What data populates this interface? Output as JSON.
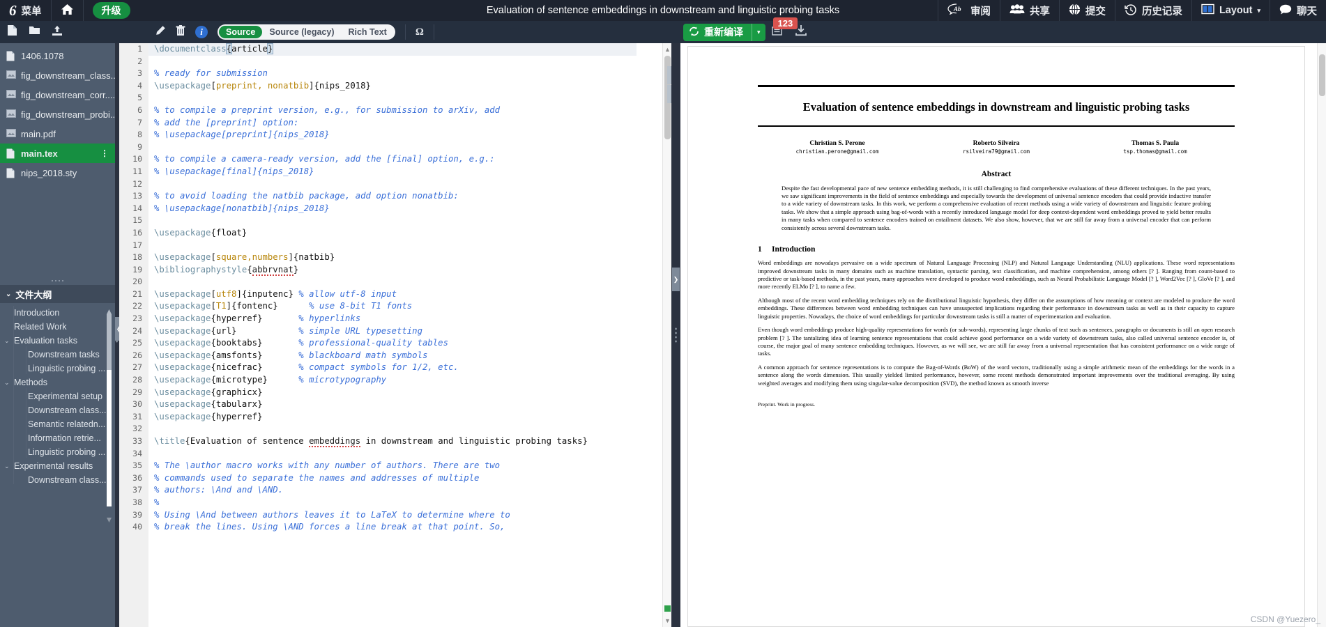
{
  "topbar": {
    "logo": "6",
    "menu_label": "菜单",
    "home_icon": "home-icon",
    "upgrade_label": "升级",
    "project_title": "Evaluation of sentence embeddings in downstream and linguistic probing tasks",
    "right_items": [
      {
        "label": "审阅",
        "icon": "review-ab-icon"
      },
      {
        "label": "共享",
        "icon": "people-icon"
      },
      {
        "label": "提交",
        "icon": "globe-icon"
      },
      {
        "label": "历史记录",
        "icon": "history-clock-icon"
      },
      {
        "label": "Layout",
        "icon": "layout-columns-icon",
        "caret": "▾"
      },
      {
        "label": "聊天",
        "icon": "chat-bubble-icon"
      }
    ]
  },
  "subbar": {
    "left_icons": [
      "new-file-icon",
      "new-folder-icon",
      "upload-icon"
    ],
    "edit_icons": [
      "rename-pencil-icon",
      "delete-trash-icon"
    ],
    "info_label": "i",
    "modes": [
      {
        "label": "Source",
        "active": true
      },
      {
        "label": "Source (legacy)",
        "active": false
      },
      {
        "label": "Rich Text",
        "active": false
      }
    ],
    "symbol_palette": "Ω",
    "recompile_label": "重新编译",
    "recompile_icon": "recycle-refresh-icon",
    "recompile_caret": "▾",
    "error_count": "123",
    "error_icon": "log-icon",
    "download_icon": "download-icon"
  },
  "sidebar": {
    "files": [
      {
        "name": "1406.1078",
        "icon": "file-icon",
        "selected": false
      },
      {
        "name": "fig_downstream_class...",
        "icon": "image-icon",
        "selected": false
      },
      {
        "name": "fig_downstream_corr....",
        "icon": "image-icon",
        "selected": false
      },
      {
        "name": "fig_downstream_probi...",
        "icon": "image-icon",
        "selected": false
      },
      {
        "name": "main.pdf",
        "icon": "image-icon",
        "selected": false
      },
      {
        "name": "main.tex",
        "icon": "file-icon",
        "selected": true,
        "kebab": "⋮"
      },
      {
        "name": "nips_2018.sty",
        "icon": "file-icon",
        "selected": false
      }
    ],
    "outline_title": "文件大纲",
    "outline_chevron": "⌄",
    "outline": [
      {
        "label": "Introduction",
        "level": 0,
        "chevron": ""
      },
      {
        "label": "Related Work",
        "level": 0,
        "chevron": ""
      },
      {
        "label": "Evaluation tasks",
        "level": 0,
        "chevron": "⌄"
      },
      {
        "label": "Downstream tasks",
        "level": 1,
        "chevron": ""
      },
      {
        "label": "Linguistic probing ...",
        "level": 1,
        "chevron": ""
      },
      {
        "label": "Methods",
        "level": 0,
        "chevron": "⌄"
      },
      {
        "label": "Experimental setup",
        "level": 1,
        "chevron": ""
      },
      {
        "label": "Downstream class...",
        "level": 1,
        "chevron": ""
      },
      {
        "label": "Semantic relatedn...",
        "level": 1,
        "chevron": ""
      },
      {
        "label": "Information retrie...",
        "level": 1,
        "chevron": ""
      },
      {
        "label": "Linguistic probing ...",
        "level": 1,
        "chevron": ""
      },
      {
        "label": "Experimental results",
        "level": 0,
        "chevron": "⌄"
      },
      {
        "label": "Downstream class...",
        "level": 1,
        "chevron": ""
      }
    ]
  },
  "editor": {
    "lines": [
      {
        "n": 1,
        "current": true,
        "segs": [
          {
            "t": "\\documentclass",
            "c": "cmd"
          },
          {
            "t": "{",
            "c": "sel-brace"
          },
          {
            "t": "article",
            "c": "arg"
          },
          {
            "t": "}",
            "c": "sel-brace"
          }
        ],
        "caret": true
      },
      {
        "n": 2,
        "segs": []
      },
      {
        "n": 3,
        "segs": [
          {
            "t": "% ready for submission",
            "c": "com"
          }
        ]
      },
      {
        "n": 4,
        "segs": [
          {
            "t": "\\usepackage",
            "c": "cmd"
          },
          {
            "t": "[",
            "c": "arg"
          },
          {
            "t": "preprint, nonatbib",
            "c": "opt"
          },
          {
            "t": "]{nips_2018}",
            "c": "arg"
          }
        ]
      },
      {
        "n": 5,
        "segs": []
      },
      {
        "n": 6,
        "segs": [
          {
            "t": "% to compile a preprint version, e.g., for submission to arXiv, add",
            "c": "com"
          }
        ]
      },
      {
        "n": 7,
        "segs": [
          {
            "t": "% add the [preprint] option:",
            "c": "com"
          }
        ]
      },
      {
        "n": 8,
        "segs": [
          {
            "t": "% \\usepackage[preprint]{nips_2018}",
            "c": "com"
          }
        ]
      },
      {
        "n": 9,
        "segs": []
      },
      {
        "n": 10,
        "segs": [
          {
            "t": "% to compile a camera-ready version, add the [final] option, e.g.:",
            "c": "com"
          }
        ]
      },
      {
        "n": 11,
        "segs": [
          {
            "t": "% \\usepackage[final]{nips_2018}",
            "c": "com"
          }
        ]
      },
      {
        "n": 12,
        "segs": []
      },
      {
        "n": 13,
        "segs": [
          {
            "t": "% to avoid loading the natbib package, add option nonatbib:",
            "c": "com"
          }
        ]
      },
      {
        "n": 14,
        "segs": [
          {
            "t": "% \\usepackage[nonatbib]{nips_2018}",
            "c": "com"
          }
        ]
      },
      {
        "n": 15,
        "segs": []
      },
      {
        "n": 16,
        "segs": [
          {
            "t": "\\usepackage",
            "c": "cmd"
          },
          {
            "t": "{float}",
            "c": "arg"
          }
        ]
      },
      {
        "n": 17,
        "segs": []
      },
      {
        "n": 18,
        "segs": [
          {
            "t": "\\usepackage",
            "c": "cmd"
          },
          {
            "t": "[",
            "c": "arg"
          },
          {
            "t": "square,numbers",
            "c": "opt"
          },
          {
            "t": "]{natbib}",
            "c": "arg"
          }
        ]
      },
      {
        "n": 19,
        "segs": [
          {
            "t": "\\bibliographystyle",
            "c": "cmd"
          },
          {
            "t": "{",
            "c": "arg"
          },
          {
            "t": "abbrvnat",
            "c": "spell"
          },
          {
            "t": "}",
            "c": "arg"
          }
        ]
      },
      {
        "n": 20,
        "segs": []
      },
      {
        "n": 21,
        "segs": [
          {
            "t": "\\usepackage",
            "c": "cmd"
          },
          {
            "t": "[",
            "c": "arg"
          },
          {
            "t": "utf8",
            "c": "opt"
          },
          {
            "t": "]{inputenc} ",
            "c": "arg"
          },
          {
            "t": "% allow utf-8 input",
            "c": "com"
          }
        ]
      },
      {
        "n": 22,
        "segs": [
          {
            "t": "\\usepackage",
            "c": "cmd"
          },
          {
            "t": "[",
            "c": "arg"
          },
          {
            "t": "T1",
            "c": "opt"
          },
          {
            "t": "]{fontenc}      ",
            "c": "arg"
          },
          {
            "t": "% use 8-bit T1 fonts",
            "c": "com"
          }
        ]
      },
      {
        "n": 23,
        "segs": [
          {
            "t": "\\usepackage",
            "c": "cmd"
          },
          {
            "t": "{hyperref}       ",
            "c": "arg"
          },
          {
            "t": "% hyperlinks",
            "c": "com"
          }
        ]
      },
      {
        "n": 24,
        "segs": [
          {
            "t": "\\usepackage",
            "c": "cmd"
          },
          {
            "t": "{url}            ",
            "c": "arg"
          },
          {
            "t": "% simple URL typesetting",
            "c": "com"
          }
        ]
      },
      {
        "n": 25,
        "segs": [
          {
            "t": "\\usepackage",
            "c": "cmd"
          },
          {
            "t": "{booktabs}       ",
            "c": "arg"
          },
          {
            "t": "% professional-quality tables",
            "c": "com"
          }
        ]
      },
      {
        "n": 26,
        "segs": [
          {
            "t": "\\usepackage",
            "c": "cmd"
          },
          {
            "t": "{amsfonts}       ",
            "c": "arg"
          },
          {
            "t": "% blackboard math symbols",
            "c": "com"
          }
        ]
      },
      {
        "n": 27,
        "segs": [
          {
            "t": "\\usepackage",
            "c": "cmd"
          },
          {
            "t": "{nicefrac}       ",
            "c": "arg"
          },
          {
            "t": "% compact symbols for 1/2, etc.",
            "c": "com"
          }
        ]
      },
      {
        "n": 28,
        "segs": [
          {
            "t": "\\usepackage",
            "c": "cmd"
          },
          {
            "t": "{microtype}      ",
            "c": "arg"
          },
          {
            "t": "% microtypography",
            "c": "com"
          }
        ]
      },
      {
        "n": 29,
        "segs": [
          {
            "t": "\\usepackage",
            "c": "cmd"
          },
          {
            "t": "{graphicx}",
            "c": "arg"
          }
        ]
      },
      {
        "n": 30,
        "segs": [
          {
            "t": "\\usepackage",
            "c": "cmd"
          },
          {
            "t": "{tabularx}",
            "c": "arg"
          }
        ]
      },
      {
        "n": 31,
        "segs": [
          {
            "t": "\\usepackage",
            "c": "cmd"
          },
          {
            "t": "{hyperref}",
            "c": "arg"
          }
        ]
      },
      {
        "n": 32,
        "segs": []
      },
      {
        "n": 33,
        "segs": [
          {
            "t": "\\title",
            "c": "cmd"
          },
          {
            "t": "{Evaluation of sentence ",
            "c": "arg"
          },
          {
            "t": "embeddings",
            "c": "spell"
          },
          {
            "t": " in downstream and linguistic probing tasks}",
            "c": "arg"
          }
        ]
      },
      {
        "n": 34,
        "segs": []
      },
      {
        "n": 35,
        "segs": [
          {
            "t": "% The \\author macro works with any number of authors. There are two",
            "c": "com"
          }
        ]
      },
      {
        "n": 36,
        "segs": [
          {
            "t": "% commands used to separate the names and addresses of multiple",
            "c": "com"
          }
        ]
      },
      {
        "n": 37,
        "segs": [
          {
            "t": "% authors: \\And and \\AND.",
            "c": "com"
          }
        ]
      },
      {
        "n": 38,
        "segs": [
          {
            "t": "%",
            "c": "com"
          }
        ]
      },
      {
        "n": 39,
        "segs": [
          {
            "t": "% Using \\And between authors leaves it to LaTeX to determine where to",
            "c": "com"
          }
        ]
      },
      {
        "n": 40,
        "segs": [
          {
            "t": "% break the lines. Using \\AND forces a line break at that point. So,",
            "c": "com"
          }
        ]
      }
    ]
  },
  "pdf": {
    "title": "Evaluation of sentence embeddings in downstream and linguistic probing tasks",
    "authors": [
      {
        "name": "Christian S. Perone",
        "email": "christian.perone@gmail.com"
      },
      {
        "name": "Roberto Silveira",
        "email": "rsilveira79@gmail.com"
      },
      {
        "name": "Thomas S. Paula",
        "email": "tsp.thomas@gmail.com"
      }
    ],
    "abstract_heading": "Abstract",
    "abstract": "Despite the fast developmental pace of new sentence embedding methods, it is still challenging to find comprehensive evaluations of these different techniques. In the past years, we saw significant improvements in the field of sentence embeddings and especially towards the development of universal sentence encoders that could provide inductive transfer to a wide variety of downstream tasks. In this work, we perform a comprehensive evaluation of recent methods using a wide variety of downstream and linguistic feature probing tasks. We show that a simple approach using bag-of-words with a recently introduced language model for deep context-dependent word embeddings proved to yield better results in many tasks when compared to sentence encoders trained on entailment datasets. We also show, however, that we are still far away from a universal encoder that can perform consistently across several downstream tasks.",
    "section_number": "1",
    "section_title": "Introduction",
    "paragraphs": [
      "Word embeddings are nowadays pervasive on a wide spectrum of Natural Language Processing (NLP) and Natural Language Understanding (NLU) applications. These word representations improved downstream tasks in many domains such as machine translation, syntactic parsing, text classification, and machine comprehension, among others [? ]. Ranging from count-based to predictive or task-based methods, in the past years, many approaches were developed to produce word embeddings, such as Neural Probabilistic Language Model [? ], Word2Vec [? ], GloVe [? ], and more recently ELMo [? ], to name a few.",
      "Although most of the recent word embedding techniques rely on the distributional linguistic hypothesis, they differ on the assumptions of how meaning or context are modeled to produce the word embeddings. These differences between word embedding techniques can have unsuspected implications regarding their performance in downstream tasks as well as in their capacity to capture linguistic properties. Nowadays, the choice of word embeddings for particular downstream tasks is still a matter of experimentation and evaluation.",
      "Even though word embeddings produce high-quality representations for words (or sub-words), representing large chunks of text such as sentences, paragraphs or documents is still an open research problem [? ]. The tantalizing idea of learning sentence representations that could achieve good performance on a wide variety of downstream tasks, also called universal sentence encoder is, of course, the major goal of many sentence embedding techniques. However, as we will see, we are still far away from a universal representation that has consistent performance on a wide range of tasks.",
      "A common approach for sentence representations is to compute the Bag-of-Words (BoW) of the word vectors, traditionally using a simple arithmetic mean of the embeddings for the words in a sentence along the words dimension. This usually yielded limited performance, however, some recent methods demonstrated important improvements over the traditional averaging. By using weighted averages and modifying them using singular-value decomposition (SVD), the method known as smooth inverse"
    ],
    "footer": "Preprint. Work in progress."
  },
  "watermark": "CSDN @Yuezero_",
  "colors": {
    "topbar_bg": "#1e2430",
    "subbar_bg": "#252f3e",
    "sidebar_bg": "#4e5c6e",
    "accent_green": "#168f41",
    "error_red": "#d9534f",
    "comment_blue": "#3a6fd8"
  }
}
